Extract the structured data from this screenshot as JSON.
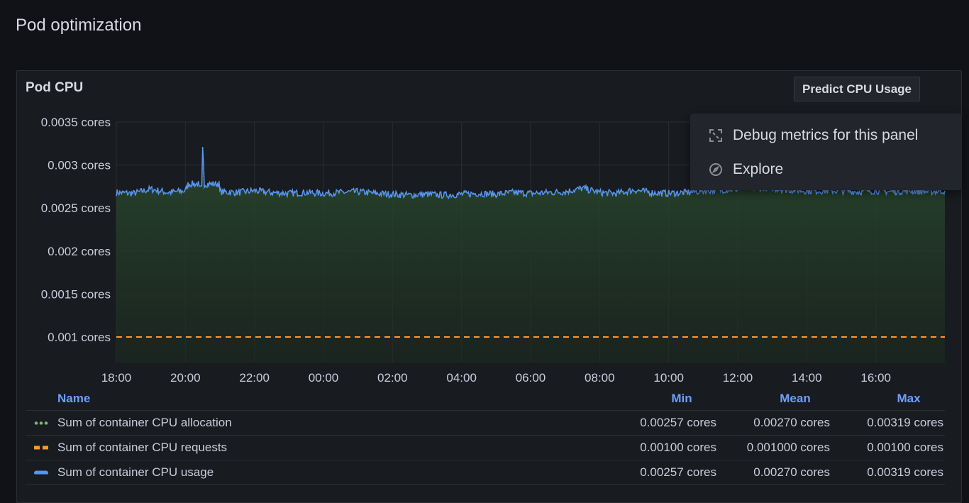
{
  "page": {
    "title": "Pod optimization"
  },
  "panel": {
    "title": "Pod CPU",
    "predict_button": "Predict CPU Usage"
  },
  "context_menu": {
    "items": [
      {
        "label": "Debug metrics for this panel",
        "icon": "debug-icon"
      },
      {
        "label": "Explore",
        "icon": "compass-icon"
      }
    ]
  },
  "legend": {
    "headers": {
      "name": "Name",
      "min": "Min",
      "mean": "Mean",
      "max": "Max"
    },
    "rows": [
      {
        "name": "Sum of container CPU allocation",
        "min": "0.00257 cores",
        "mean": "0.00270 cores",
        "max": "0.00319 cores",
        "color": "#73bf69",
        "style": "dots"
      },
      {
        "name": "Sum of container CPU requests",
        "min": "0.00100 cores",
        "mean": "0.001000 cores",
        "max": "0.00100 cores",
        "color": "#ff9830",
        "style": "dashes"
      },
      {
        "name": "Sum of container CPU usage",
        "min": "0.00257 cores",
        "mean": "0.00270 cores",
        "max": "0.00319 cores",
        "color": "#5794f2",
        "style": "solid"
      }
    ]
  },
  "chart_data": {
    "type": "line",
    "ylabel": "",
    "xlabel": "",
    "ylim": [
      0.0007,
      0.0035
    ],
    "yticks": [
      "0.0035 cores",
      "0.003 cores",
      "0.0025 cores",
      "0.002 cores",
      "0.0015 cores",
      "0.001 cores"
    ],
    "ytick_values": [
      0.0035,
      0.003,
      0.0025,
      0.002,
      0.0015,
      0.001
    ],
    "xticks": [
      "18:00",
      "20:00",
      "22:00",
      "00:00",
      "02:00",
      "04:00",
      "06:00",
      "08:00",
      "10:00",
      "12:00",
      "14:00",
      "16:00"
    ],
    "x_hours_range": [
      0,
      24
    ],
    "series": [
      {
        "name": "Sum of container CPU usage",
        "color": "#5794f2",
        "values": [
          0.00268,
          0.00267,
          0.00272,
          0.00268,
          0.0027,
          0.00319,
          0.00269,
          0.00268,
          0.0027,
          0.00268,
          0.00267,
          0.00268,
          0.00267,
          0.00268,
          0.00269,
          0.00267,
          0.00266,
          0.00265,
          0.00266,
          0.00265,
          0.00266,
          0.00267,
          0.00266,
          0.00268,
          0.00267,
          0.00268,
          0.00269,
          0.00273,
          0.00268,
          0.00267,
          0.00271,
          0.00268,
          0.00267,
          0.00268,
          0.0027,
          0.00271,
          0.00272,
          0.00274,
          0.00273,
          0.00271,
          0.0027,
          0.0027,
          0.0027,
          0.00269,
          0.0027,
          0.00269,
          0.0027,
          0.00269,
          0.0027
        ]
      },
      {
        "name": "Sum of container CPU requests",
        "color": "#ff9830",
        "values": [
          0.001
        ]
      }
    ]
  }
}
